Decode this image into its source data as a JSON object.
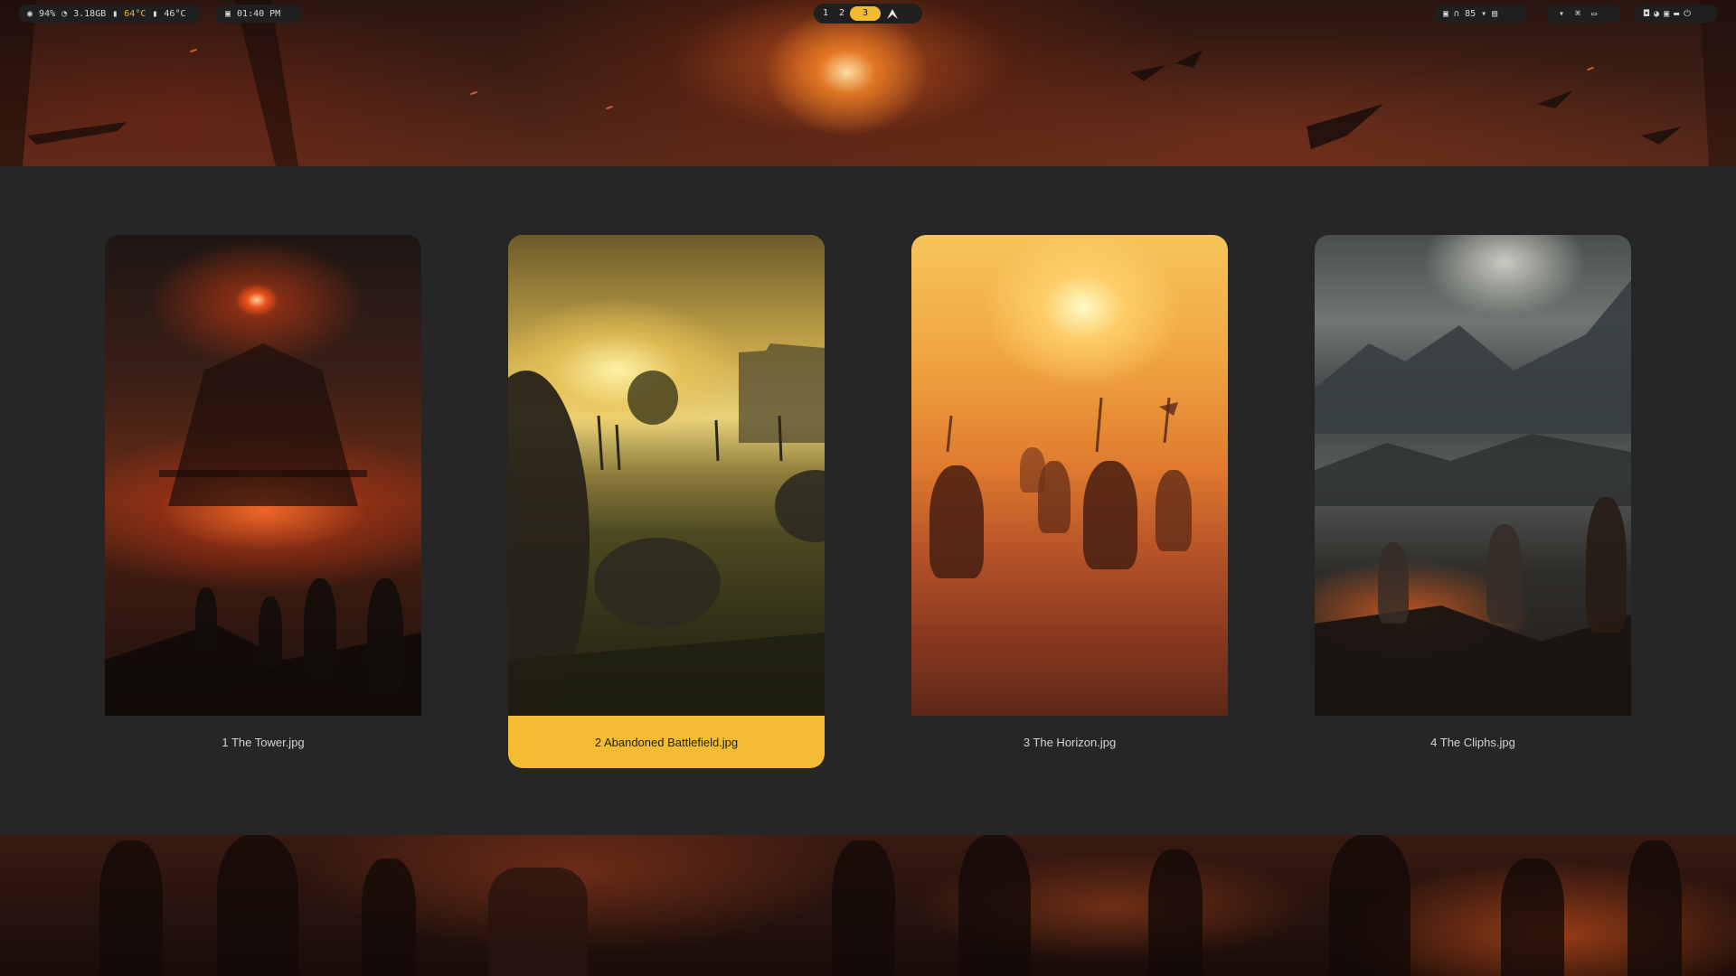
{
  "topbar": {
    "system": {
      "cpu": "94%",
      "memory": "3.18GB",
      "cpu_temp": "64°C",
      "gpu_temp": "46°C",
      "icons": [
        "cpu-icon",
        "memory-icon",
        "thermometer-icon",
        "thermometer-icon"
      ]
    },
    "clock": {
      "time": "01:40 PM",
      "icon": "calendar-icon"
    },
    "workspaces": {
      "items": [
        "1",
        "2",
        "3"
      ],
      "active": "3",
      "launcher_icon": "arch-logo-icon"
    },
    "tray": {
      "headphone_volume": "85",
      "icons": [
        "screenshot-icon",
        "headphones-icon",
        "microphone-icon",
        "keyboard-icon"
      ]
    },
    "controls": {
      "icons": [
        "microphone-icon",
        "network-icon",
        "display-icon"
      ]
    },
    "power": {
      "icons": [
        "lock-icon",
        "palette-icon",
        "screenshot-icon",
        "folder-icon",
        "power-icon"
      ]
    }
  },
  "wallpaper_picker": {
    "selected_index": 1,
    "items": [
      {
        "label": "1 The Tower.jpg"
      },
      {
        "label": "2 Abandoned Battlefield.jpg"
      },
      {
        "label": "3 The Horizon.jpg"
      },
      {
        "label": "4 The Cliphs.jpg"
      }
    ]
  },
  "colors": {
    "accent": "#f4bc34",
    "panel_bg": "#262626",
    "bar_bg": "#1f1f1f",
    "warm_text": "#f0b43c"
  }
}
